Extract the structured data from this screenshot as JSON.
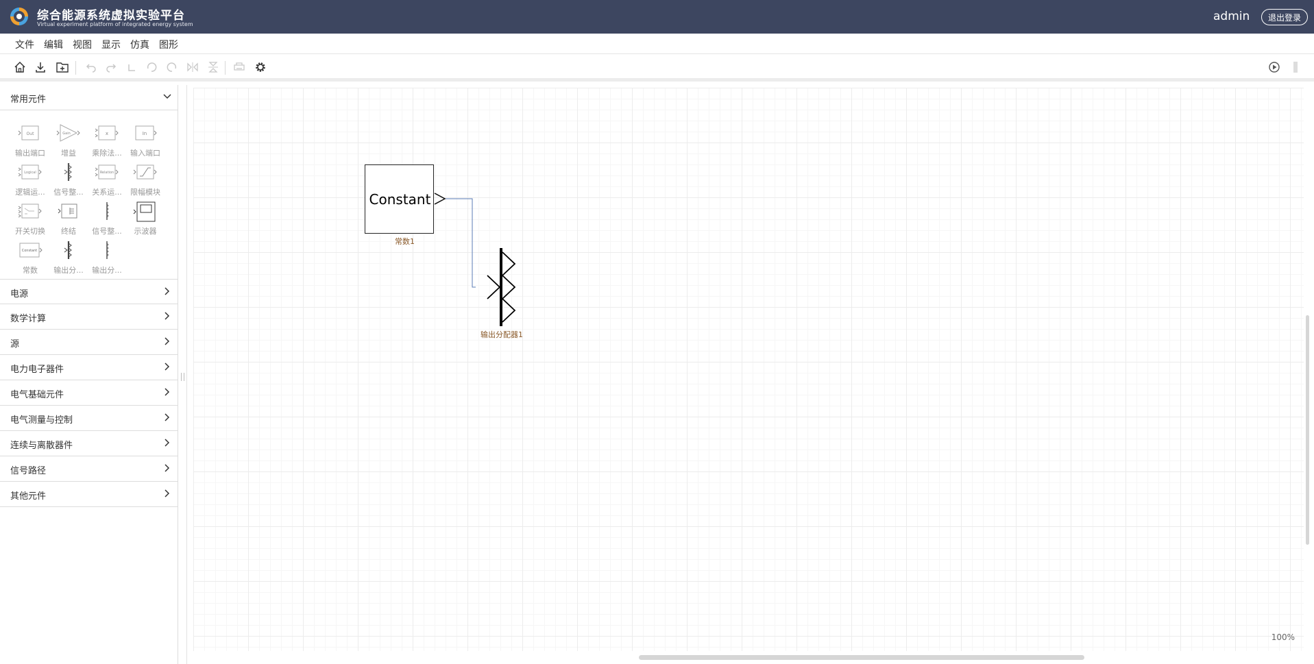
{
  "header": {
    "title": "综合能源系统虚拟实验平台",
    "subtitle": "Virtual experiment platform of integrated energy system",
    "user": "admin",
    "logout_label": "退出登录"
  },
  "menu": [
    "文件",
    "编辑",
    "视图",
    "显示",
    "仿真",
    "图形"
  ],
  "toolbar": {
    "icons": [
      "home-icon",
      "download-icon",
      "add-folder-icon",
      "undo-icon",
      "redo-icon",
      "rotate-icon",
      "rotate-left-icon",
      "rotate-right-icon",
      "flip-horizontal-icon",
      "flip-vertical-icon",
      "print-icon",
      "gear-icon",
      "run-icon",
      "stop-icon"
    ]
  },
  "sidebar": {
    "open_category": "常用元件",
    "components": [
      {
        "label": "输出端口",
        "text": "Out"
      },
      {
        "label": "增益",
        "text": "Gain"
      },
      {
        "label": "乘除法...",
        "text": "x"
      },
      {
        "label": "输入端口",
        "text": "In"
      },
      {
        "label": "逻辑运...",
        "text": "Logical"
      },
      {
        "label": "信号整...",
        "text": ""
      },
      {
        "label": "关系运...",
        "text": "Relation"
      },
      {
        "label": "限幅模块",
        "text": ""
      },
      {
        "label": "开关切换",
        "text": ""
      },
      {
        "label": "终结",
        "text": ""
      },
      {
        "label": "信号整...",
        "text": ""
      },
      {
        "label": "示波器",
        "text": ""
      },
      {
        "label": "常数",
        "text": "Constant"
      },
      {
        "label": "输出分...",
        "text": ""
      },
      {
        "label": "输出分...",
        "text": ""
      }
    ],
    "categories": [
      "电源",
      "数学计算",
      "源",
      "电力电子器件",
      "电气基础元件",
      "电气测量与控制",
      "连续与离散器件",
      "信号路径",
      "其他元件"
    ]
  },
  "canvas": {
    "constant_block_text": "Constant",
    "constant_block_label": "常数1",
    "splitter_block_label": "输出分配器1",
    "zoom": "100%"
  },
  "colors": {
    "header_bg": "#3d4660",
    "wire": "#5a7bb5",
    "block_label": "#8a5a2a"
  }
}
